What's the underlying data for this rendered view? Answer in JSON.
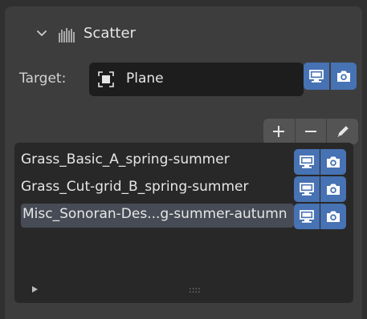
{
  "panel": {
    "title": "Scatter",
    "title_icon": "scatter-grid-icon",
    "collapse_icon": "chevron-down-icon"
  },
  "target": {
    "label": "Target:",
    "value": "Plane",
    "icon": "object-plane-icon",
    "toggles": [
      "monitor-icon",
      "camera-icon"
    ]
  },
  "tools": [
    {
      "name": "add-button",
      "icon": "plus-icon",
      "glyph": "+"
    },
    {
      "name": "remove-button",
      "icon": "minus-icon",
      "glyph": "−"
    },
    {
      "name": "edit-button",
      "icon": "pencil-icon",
      "glyph": ""
    }
  ],
  "list": {
    "items": [
      {
        "label": "Grass_Basic_A_spring-summer",
        "selected": false
      },
      {
        "label": "Grass_Cut-grid_B_spring-summer",
        "selected": false
      },
      {
        "label": "Misc_Sonoran-Des...g-summer-autumn",
        "selected": true
      }
    ],
    "expand_icon": "play-triangle-icon",
    "resize_grip": "::::"
  },
  "colors": {
    "accent": "#4772b3",
    "panel": "#3d3d3d",
    "field": "#1d1d1d",
    "list_bg": "#282828",
    "selected_row": "#474b55"
  }
}
